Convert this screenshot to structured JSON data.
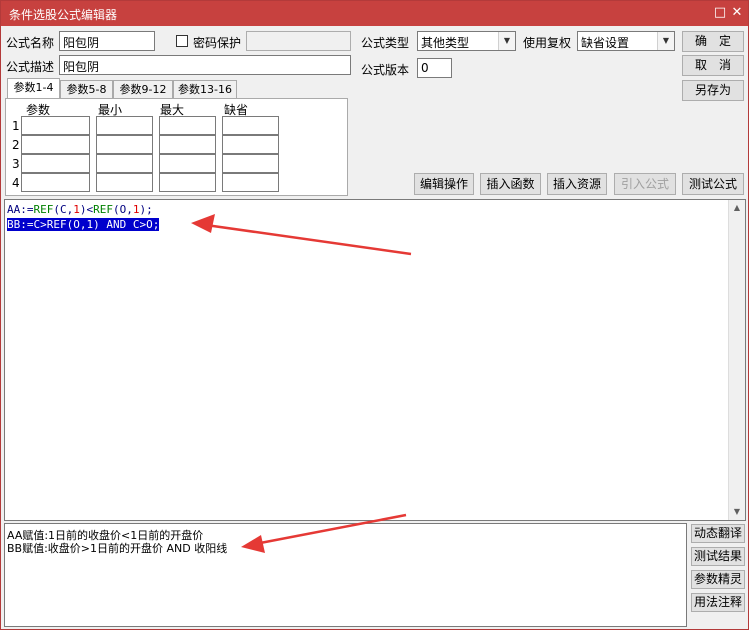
{
  "window": {
    "title": "条件选股公式编辑器",
    "minimize": "□",
    "close": "✕"
  },
  "form": {
    "name_label": "公式名称",
    "name_value": "阳包阴",
    "password_label": "密码保护",
    "password_value": "",
    "desc_label": "公式描述",
    "desc_value": "阳包阴",
    "type_label": "公式类型",
    "type_value": "其他类型",
    "restore_label": "使用复权",
    "restore_value": "缺省设置",
    "version_label": "公式版本",
    "version_value": "0"
  },
  "buttons": {
    "ok": "确　定",
    "cancel": "取　消",
    "save_as": "另存为",
    "edit_op": "编辑操作",
    "insert_func": "插入函数",
    "insert_res": "插入资源",
    "import_formula": "引入公式",
    "test_formula": "测试公式"
  },
  "tabs": [
    "参数1-4",
    "参数5-8",
    "参数9-12",
    "参数13-16"
  ],
  "params": {
    "headers": [
      "参数",
      "最小",
      "最大",
      "缺省"
    ],
    "rows": [
      "1",
      "2",
      "3",
      "4"
    ]
  },
  "editor": {
    "line1": {
      "part1": "AA:=",
      "part2": "REF",
      "part3": "(C,",
      "part4": "1",
      "part5": ")<",
      "part6": "REF",
      "part7": "(O,",
      "part8": "1",
      "part9": ");"
    },
    "line2": "BB:=C>REF(O,1) AND C>O;"
  },
  "description": {
    "line1": "AA赋值:1日前的收盘价<1日前的开盘价",
    "line2": "BB赋值:收盘价>1日前的开盘价 AND 收阳线"
  },
  "side_buttons": [
    "动态翻译",
    "测试结果",
    "参数精灵",
    "用法注释"
  ],
  "colors": {
    "titlebar": "#c7413f",
    "selection": "#0000cc",
    "arrow": "#e53935",
    "func": "#008000"
  }
}
